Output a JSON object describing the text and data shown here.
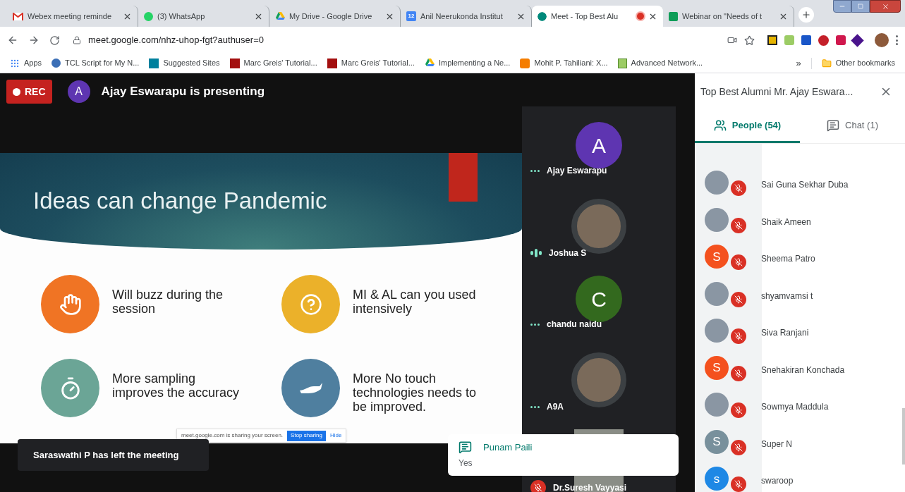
{
  "browser": {
    "tabs": [
      {
        "title": "Webex meeting reminde",
        "kind": "gmail",
        "selected": false,
        "recording": false
      },
      {
        "title": "(3) WhatsApp",
        "kind": "whatsapp",
        "selected": false,
        "recording": false
      },
      {
        "title": "My Drive - Google Drive",
        "kind": "drive",
        "selected": false,
        "recording": false
      },
      {
        "title": "Anil Neerukonda Institut",
        "kind": "calendar",
        "badge": "12",
        "selected": false,
        "recording": false
      },
      {
        "title": "Meet - Top Best Alu",
        "kind": "meet",
        "selected": true,
        "recording": true
      },
      {
        "title": "Webinar on \"Needs of t",
        "kind": "sheets",
        "selected": false,
        "recording": false
      }
    ],
    "address": "meet.google.com/nhz-uhop-fgt?authuser=0",
    "bookmarks": [
      {
        "label": "Apps",
        "kind": "apps"
      },
      {
        "label": "TCL Script for My N...",
        "kind": "globe"
      },
      {
        "label": "Suggested Sites",
        "kind": "bing"
      },
      {
        "label": "Marc Greis' Tutorial...",
        "kind": "isi"
      },
      {
        "label": "Marc Greis' Tutorial...",
        "kind": "isi"
      },
      {
        "label": "Implementing a Ne...",
        "kind": "drive"
      },
      {
        "label": "Mohit P. Tahiliani: X...",
        "kind": "blogger"
      },
      {
        "label": "Advanced Network...",
        "kind": "doc"
      }
    ],
    "more": "»",
    "other_bookmarks": "Other bookmarks"
  },
  "meeting": {
    "rec": "REC",
    "presenter_initial": "A",
    "presenting": "Ajay Eswarapu is presenting",
    "slide": {
      "title": "Ideas can change Pandemic",
      "items": [
        {
          "text": "Will buzz during the session",
          "kind": "clap",
          "color": "#f07424"
        },
        {
          "text": "MI & AL can you used intensively",
          "kind": "question",
          "color": "#ebb12a"
        },
        {
          "text": "More sampling improves the accuracy",
          "kind": "timer",
          "color": "#6ba596"
        },
        {
          "text": "More No touch technologies needs to be improved.",
          "kind": "hand",
          "color": "#4f7f9f"
        }
      ]
    },
    "share_bar": {
      "message": "meet.google.com is sharing your screen.",
      "stop": "Stop sharing",
      "hide": "Hide"
    },
    "tiles": [
      {
        "name": "Ajay Eswarapu",
        "kind": "letter",
        "initial": "A",
        "color": "#5e35b1",
        "speaking": false
      },
      {
        "name": "Joshua S",
        "kind": "photo",
        "speaking": true
      },
      {
        "name": "chandu naidu",
        "kind": "letter",
        "initial": "C",
        "color": "#33691e",
        "speaking": false
      },
      {
        "name": "A9A",
        "kind": "photo",
        "speaking": false
      },
      {
        "name": "Dr.Suresh Vayyasi",
        "kind": "video",
        "muted": true
      }
    ],
    "toast": "Saraswathi P has left the meeting",
    "chat_notification": {
      "name": "Punam Paili",
      "message": "Yes"
    }
  },
  "panel": {
    "title": "Top Best Alumni Mr. Ajay Eswara...",
    "tabs": [
      {
        "label": "People (54)",
        "kind": "people",
        "selected": true
      },
      {
        "label": "Chat (1)",
        "kind": "chat",
        "selected": false
      }
    ],
    "people": [
      {
        "name": "Sai Guna Sekhar Duba",
        "kind": "photo",
        "muted": true
      },
      {
        "name": "Shaik Ameen",
        "kind": "photo",
        "muted": true
      },
      {
        "name": "Sheema Patro",
        "kind": "letter",
        "initial": "S",
        "color": "#f4511e",
        "muted": true
      },
      {
        "name": "shyamvamsi t",
        "kind": "photo",
        "muted": true
      },
      {
        "name": "Siva Ranjani",
        "kind": "photo",
        "muted": true
      },
      {
        "name": "Snehakiran Konchada",
        "kind": "letter",
        "initial": "S",
        "color": "#f4511e",
        "muted": true
      },
      {
        "name": "Sowmya Maddula",
        "kind": "photo",
        "muted": true
      },
      {
        "name": "Super N",
        "kind": "letter",
        "initial": "S",
        "color": "#78909c",
        "muted": true
      },
      {
        "name": "swaroop",
        "kind": "letter",
        "initial": "s",
        "color": "#1e88e5",
        "muted": true
      }
    ]
  }
}
